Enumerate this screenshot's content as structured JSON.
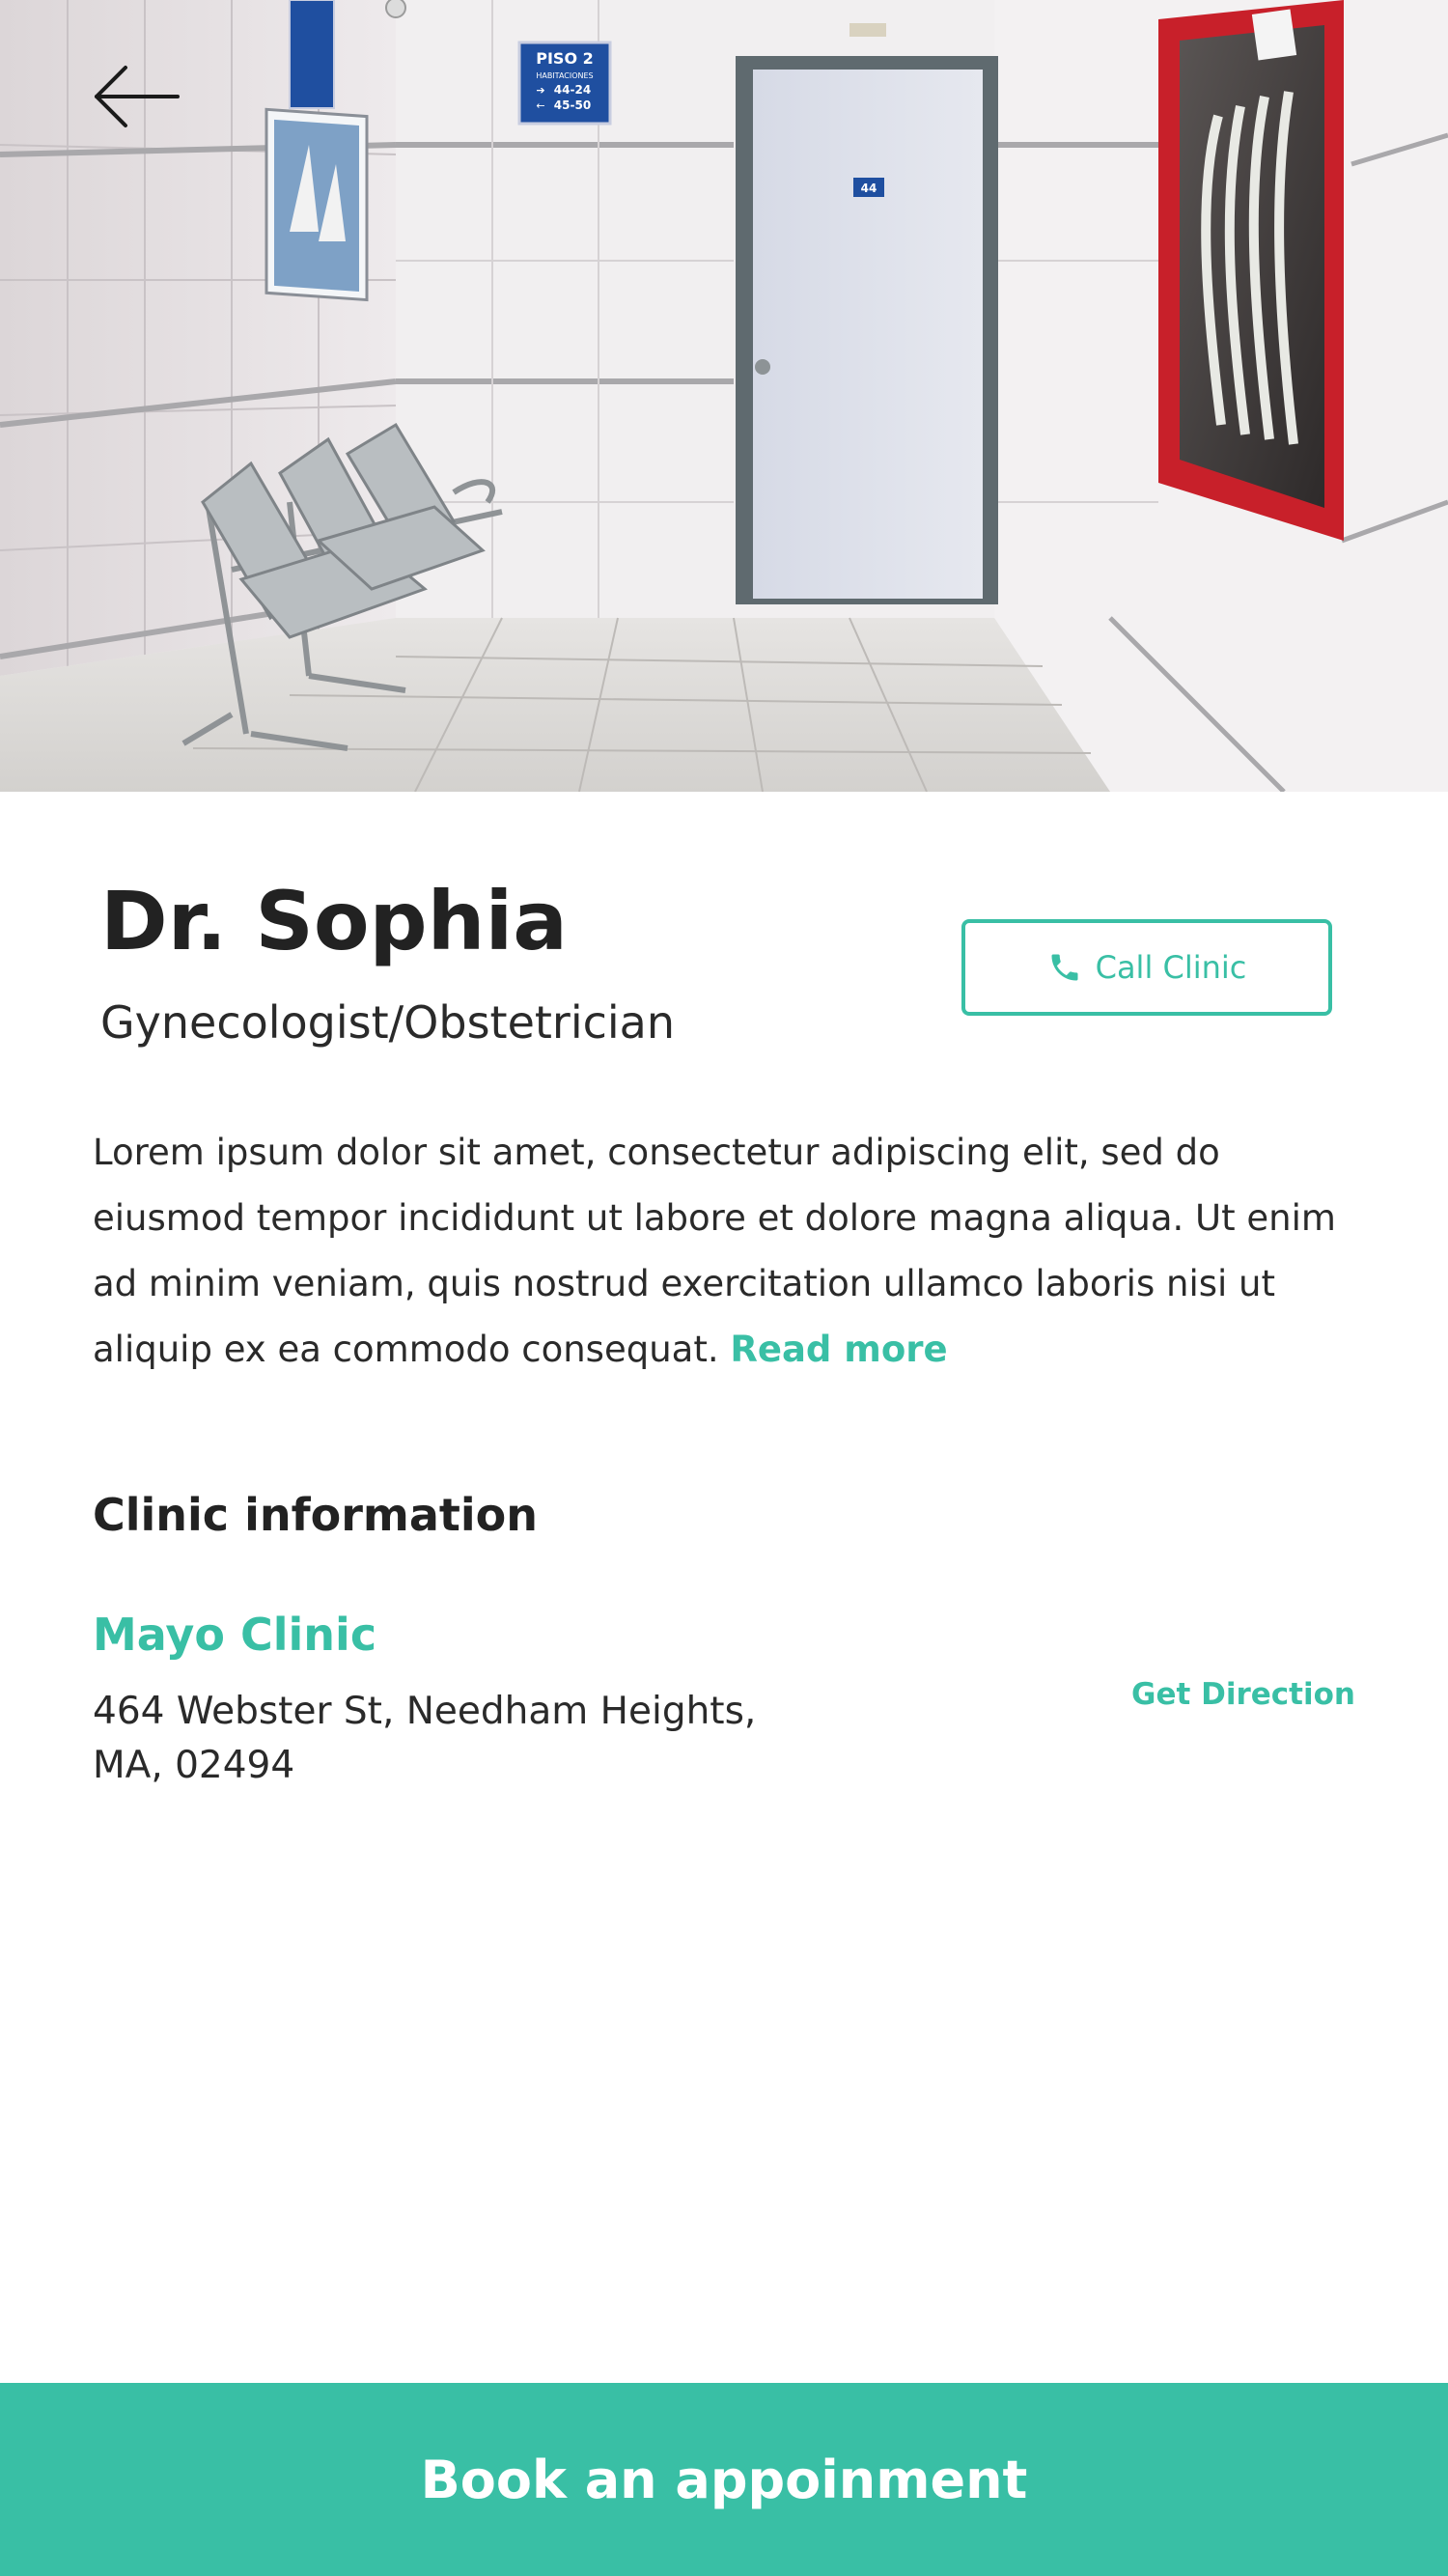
{
  "hero": {
    "image_name": "clinic-hallway-photo",
    "signage": {
      "floor_sign_title": "PISO 2",
      "floor_sign_subtitle": "HABITACIONES",
      "floor_sign_line1": "44-24",
      "floor_sign_line2": "45-50",
      "door_number": "44"
    }
  },
  "nav": {
    "back_icon": "arrow-left-icon"
  },
  "doctor": {
    "name": "Dr. Sophia",
    "specialty": "Gynecologist/Obstetrician",
    "description": "Lorem ipsum dolor sit amet, consectetur adipiscing elit, sed do eiusmod tempor incididunt ut labore et dolore magna aliqua. Ut enim ad minim veniam, quis nostrud exercitation ullamco laboris nisi ut aliquip ex ea commodo consequat.",
    "read_more_label": "Read more"
  },
  "actions": {
    "call_label": "Call Clinic",
    "call_icon": "phone-icon",
    "book_label": "Book an appoinment"
  },
  "clinic": {
    "heading": "Clinic information",
    "name": "Mayo Clinic",
    "address_line1": "464 Webster St, Needham Heights,",
    "address_line2": "MA, 02494",
    "direction_label": "Get Direction"
  },
  "colors": {
    "accent": "#39bfa5",
    "text": "#222222",
    "background": "#ffffff",
    "door_frame_red": "#c8202a"
  }
}
